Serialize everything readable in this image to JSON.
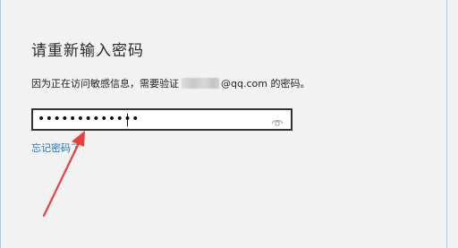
{
  "dialog": {
    "title": "请重新输入密码",
    "message_before": "因为正在访问敏感信息，需要验证",
    "message_after": "@qq.com 的密码。",
    "password": {
      "masked_value": "•••••••••••••"
    },
    "forgot_password_label": "忘记密码了"
  },
  "icons": {
    "reveal": "eye-icon"
  },
  "colors": {
    "link": "#1a76c4",
    "border": "#333333",
    "annotation_arrow": "#e8403a"
  }
}
